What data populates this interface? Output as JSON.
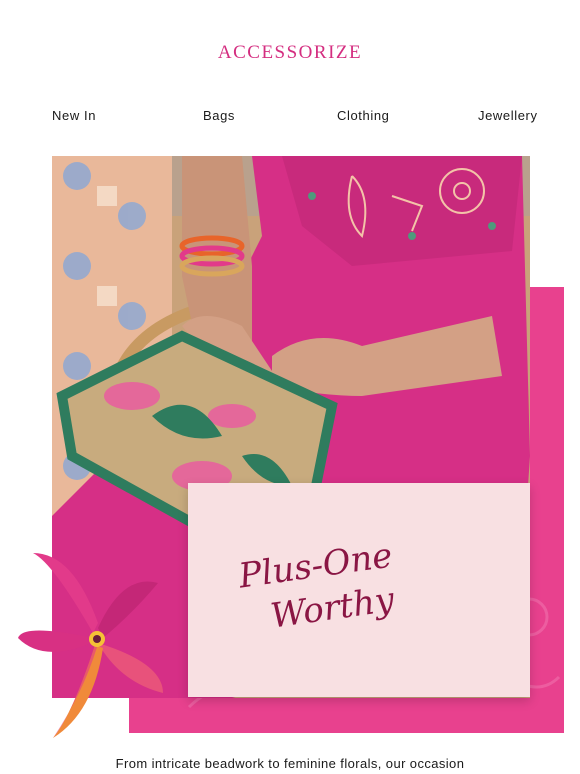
{
  "header": {
    "logo": "ACCESSORIZE"
  },
  "nav": {
    "items": [
      "New In",
      "Bags",
      "Clothing",
      "Jewellery"
    ]
  },
  "hero": {
    "card_line1": "Plus-One",
    "card_line2": "Worthy"
  },
  "body": {
    "text": "From intricate beadwork to feminine florals, our occasion"
  },
  "colors": {
    "brand": "#d42e80",
    "accent_pink": "#e8418e",
    "card": "#f8e0e2"
  },
  "icons": {
    "flower": "flower-illustration"
  }
}
